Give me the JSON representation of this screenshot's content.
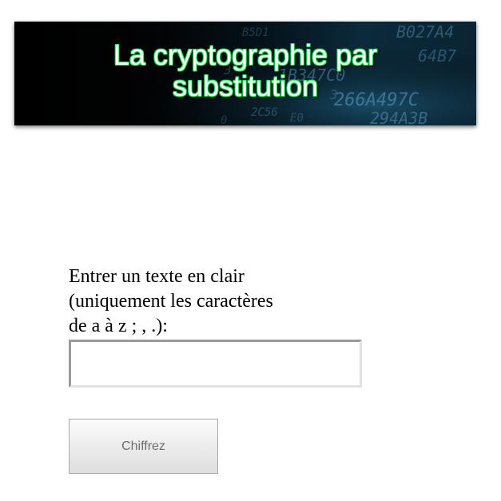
{
  "banner": {
    "title_line1": "La cryptographie par",
    "title_line2": "substitution",
    "background_glyphs": [
      "B5D1",
      "B027A4",
      "64B7",
      "3",
      "1B347C0",
      "266A497C",
      "3",
      "294A3B",
      "2C56",
      "E0",
      "0"
    ]
  },
  "form": {
    "prompt_line1": "Entrer un texte en clair",
    "prompt_line2": "(uniquement les caractères",
    "prompt_line3": "de a à z ; , .):",
    "input_value": "",
    "input_placeholder": "",
    "button_label": "Chiffrez"
  },
  "colors": {
    "banner_text_glow": "#1fd14a",
    "banner_bg_dark": "#000000",
    "banner_bg_blue": "#0b2a3a",
    "hex_digits": "#4b86a8"
  }
}
